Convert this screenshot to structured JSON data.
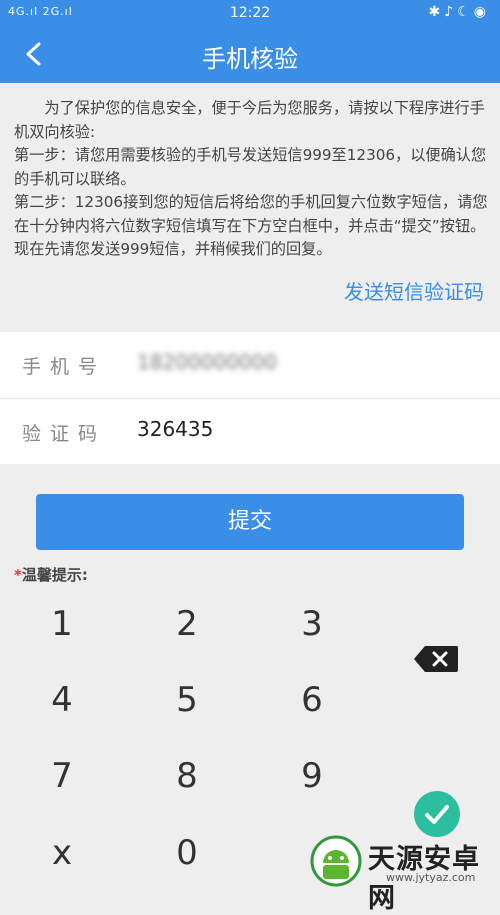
{
  "status_bar": {
    "signal_left": "4G.ıl 2G.ıl",
    "time": "12:22",
    "right_icons": [
      "bluetooth-icon",
      "mute-icon",
      "moon-icon",
      "location-icon"
    ]
  },
  "header": {
    "title": "手机核验"
  },
  "notice": {
    "intro": "为了保护您的信息安全，便于今后为您服务，请按以下程序进行手机双向核验:",
    "step1": "第一步：请您用需要核验的手机号发送短信999至12306，以便确认您的手机可以联络。",
    "step2": "第二步：12306接到您的短信后将给您的手机回复六位数字短信，请您在十分钟内将六位数字短信填写在下方空白框中，并点击“提交”按钮。现在先请您发送999短信，并稍候我们的回复。"
  },
  "send_sms_label": "发送短信验证码",
  "form": {
    "phone_label": "手机号",
    "phone_value": "18200000000",
    "code_label": "验证码",
    "code_value": "326435"
  },
  "submit_label": "提交",
  "tip": {
    "star": "*",
    "label": "温馨提示:"
  },
  "keypad": {
    "keys": [
      "1",
      "2",
      "3",
      "4",
      "5",
      "6",
      "7",
      "8",
      "9",
      "x",
      "0"
    ]
  },
  "watermark": {
    "name": "天源安卓网",
    "url": "www.jytyaz.com"
  },
  "colors": {
    "primary": "#3a8ee6",
    "confirm": "#2bbfa0",
    "background": "#eeeeee"
  }
}
